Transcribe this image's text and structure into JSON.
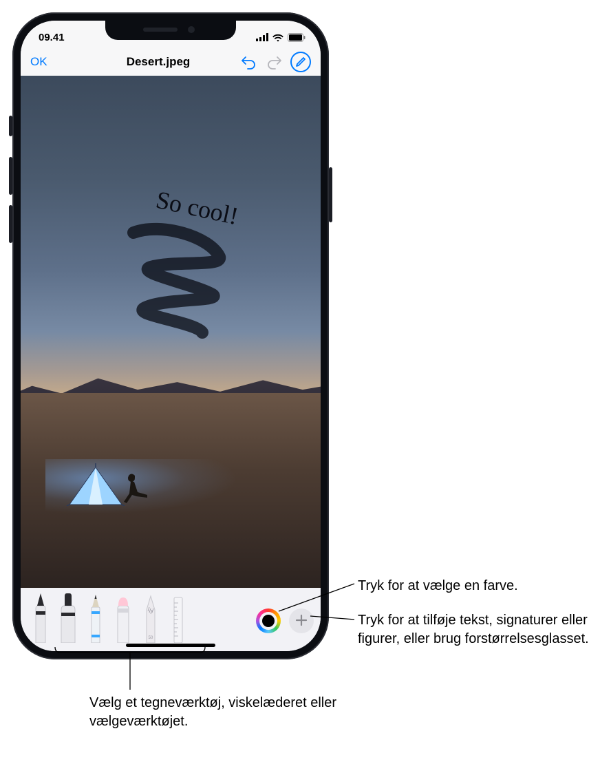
{
  "status": {
    "time": "09.41"
  },
  "nav": {
    "ok_label": "OK",
    "title": "Desert.jpeg"
  },
  "annotation": {
    "text": "So cool!"
  },
  "toolbar": {
    "current_color": "#000000"
  },
  "callouts": {
    "color": "Tryk for at vælge en farve.",
    "add": "Tryk for at tilføje tekst, signaturer eller figurer, eller brug forstørrelsesglasset.",
    "tools": "Vælg et tegneværktøj, viskelæderet eller vælgeværktøjet."
  }
}
